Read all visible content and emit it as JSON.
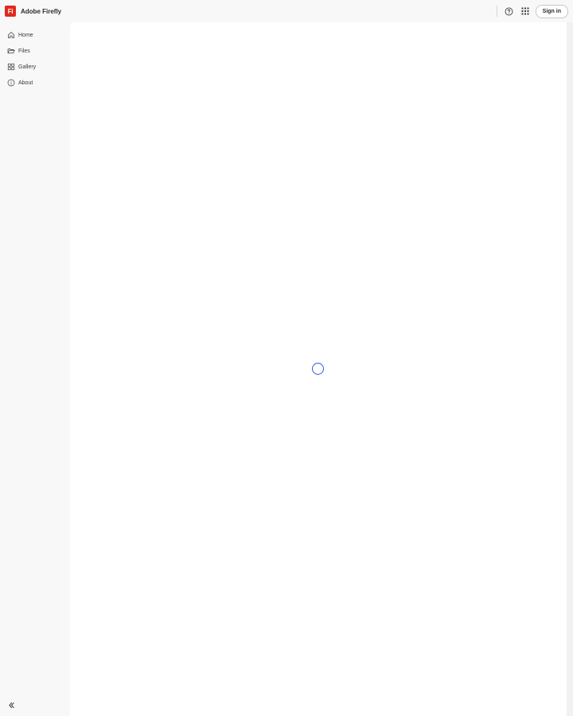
{
  "app": {
    "brand_logo_text": "Fi",
    "brand_name": "Adobe Firefly",
    "brand_color": "#e12a1c",
    "accent_color": "#2e5cd6"
  },
  "header": {
    "help_icon": "help-circle-icon",
    "apps_icon": "apps-grid-icon",
    "sign_in_label": "Sign in"
  },
  "sidebar": {
    "items": [
      {
        "label": "Home",
        "icon": "home-icon"
      },
      {
        "label": "Files",
        "icon": "folder-icon"
      },
      {
        "label": "Gallery",
        "icon": "gallery-icon"
      },
      {
        "label": "About",
        "icon": "info-icon"
      }
    ],
    "collapse_icon": "chevron-double-left-icon"
  },
  "main": {
    "loading_indicator": "spinner"
  }
}
